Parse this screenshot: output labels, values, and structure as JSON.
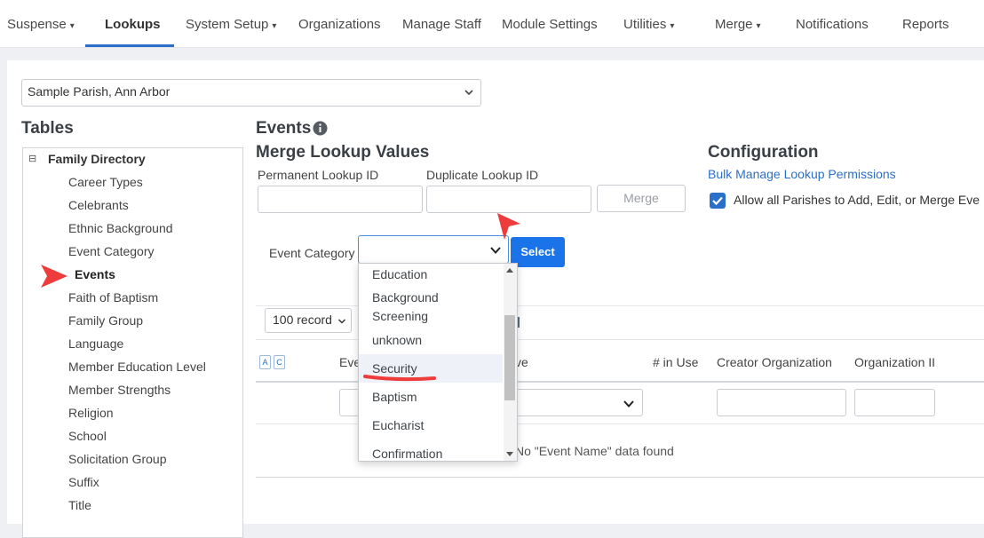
{
  "nav": {
    "items": [
      {
        "label": "Suspense",
        "caret": "▾"
      },
      {
        "label": "Lookups"
      },
      {
        "label": "System Setup",
        "caret": "▾"
      },
      {
        "label": "Organizations"
      },
      {
        "label": "Manage Staff"
      },
      {
        "label": "Module Settings"
      },
      {
        "label": "Utilities",
        "caret": "▾"
      },
      {
        "label": "Merge",
        "caret": "▾"
      },
      {
        "label": "Notifications"
      },
      {
        "label": "Reports"
      }
    ],
    "active": "Lookups"
  },
  "parish_select": {
    "value": "Sample Parish, Ann Arbor"
  },
  "tables": {
    "heading": "Tables",
    "parent": "Family Directory",
    "items": [
      "Career Types",
      "Celebrants",
      "Ethnic Background",
      "Event Category",
      "Events",
      "Faith of Baptism",
      "Family Group",
      "Language",
      "Member Education Level",
      "Member Strengths",
      "Religion",
      "School",
      "Solicitation Group",
      "Suffix",
      "Title"
    ],
    "selected": "Events"
  },
  "events": {
    "heading": "Events"
  },
  "merge": {
    "heading": "Merge Lookup Values",
    "permanent_label": "Permanent Lookup ID",
    "duplicate_label": "Duplicate Lookup ID",
    "button": "Merge"
  },
  "config": {
    "heading": "Configuration",
    "link": "Bulk Manage Lookup Permissions",
    "checkbox_label": "Allow all Parishes to Add, Edit, or Merge Eve",
    "checked": true
  },
  "category": {
    "label": "Event Category",
    "value": "",
    "select_button": "Select",
    "options": [
      "Education",
      "Background Screening",
      "unknown",
      "Security",
      "Baptism",
      "Eucharist",
      "Confirmation"
    ],
    "highlighted": "Security"
  },
  "grid": {
    "record_select": "100 record",
    "sort_buttons": [
      "A",
      "C"
    ],
    "columns": [
      "Eve",
      "ve",
      "# in Use",
      "Creator Organization",
      "Organization II"
    ],
    "empty_message": "No \"Event Name\" data found"
  },
  "colors": {
    "accent": "#2a6fc9",
    "button_primary": "#1a73e8",
    "annotation_red": "#ee3b3b"
  }
}
